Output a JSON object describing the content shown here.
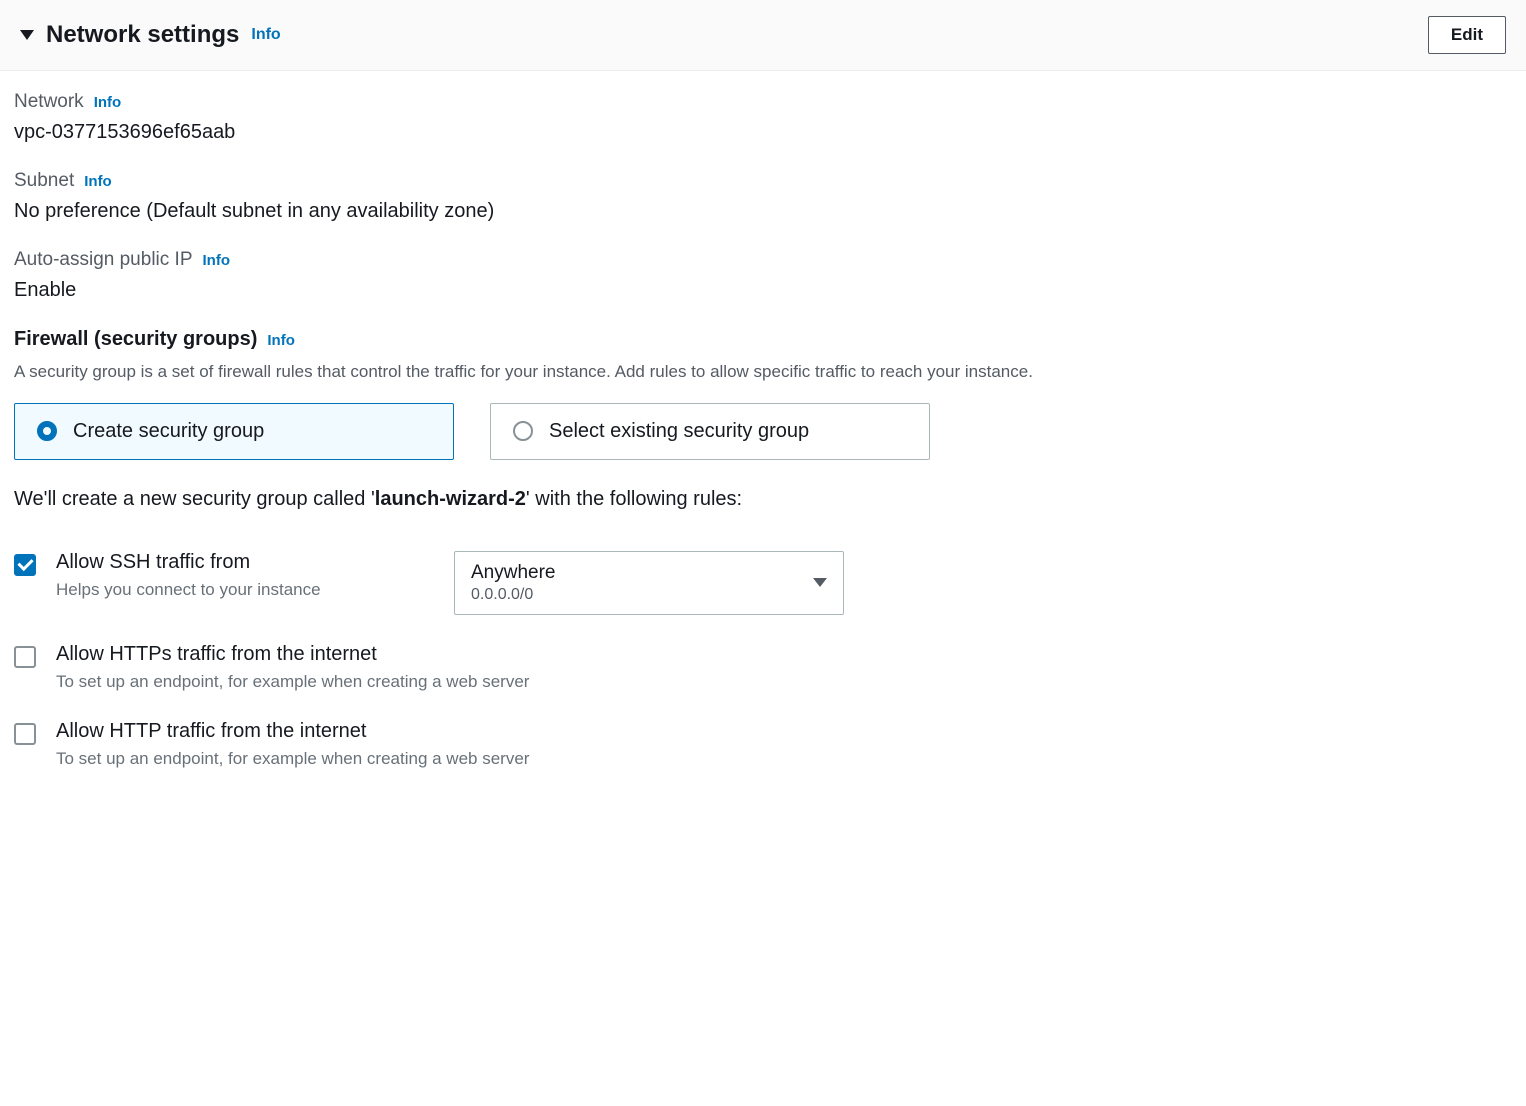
{
  "header": {
    "title": "Network settings",
    "info": "Info",
    "edit": "Edit"
  },
  "network": {
    "label": "Network",
    "info": "Info",
    "value": "vpc-0377153696ef65aab"
  },
  "subnet": {
    "label": "Subnet",
    "info": "Info",
    "value": "No preference (Default subnet in any availability zone)"
  },
  "publicIp": {
    "label": "Auto-assign public IP",
    "info": "Info",
    "value": "Enable"
  },
  "firewall": {
    "title": "Firewall (security groups)",
    "info": "Info",
    "desc": "A security group is a set of firewall rules that control the traffic for your instance. Add rules to allow specific traffic to reach your instance.",
    "option_create": "Create security group",
    "option_select": "Select existing security group",
    "sg_text_pre": "We'll create a new security group called '",
    "sg_name": "launch-wizard-2",
    "sg_text_post": "' with the following rules:"
  },
  "rules": {
    "ssh": {
      "label": "Allow SSH traffic from",
      "hint": "Helps you connect to your instance",
      "source_primary": "Anywhere",
      "source_secondary": "0.0.0.0/0"
    },
    "https": {
      "label": "Allow HTTPs traffic from the internet",
      "hint": "To set up an endpoint, for example when creating a web server"
    },
    "http": {
      "label": "Allow HTTP traffic from the internet",
      "hint": "To set up an endpoint, for example when creating a web server"
    }
  }
}
